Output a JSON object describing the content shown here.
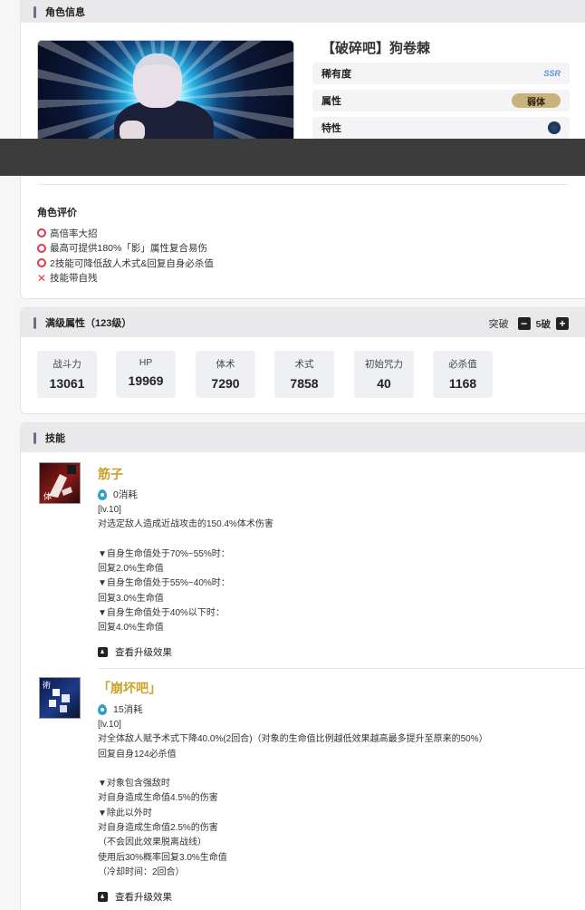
{
  "info": {
    "section_title": "角色信息",
    "char_name": "【破碎吧】狗卷棘",
    "attrs": {
      "rarity_label": "稀有度",
      "rarity_value": "SSR",
      "type_label": "属性",
      "type_value": "弱体",
      "trait_label": "特性"
    },
    "eval_title": "角色评价",
    "eval_items": [
      {
        "mark": "o",
        "text": "高倍率大招"
      },
      {
        "mark": "o",
        "text": "最高可提供180%「影」属性复合易伤"
      },
      {
        "mark": "o",
        "text": "2技能可降低敌人术式&回复自身必杀值"
      },
      {
        "mark": "x",
        "text": "技能带自残"
      }
    ]
  },
  "stats": {
    "section_title": "满级属性（123级）",
    "breakthrough_label": "突破",
    "breakthrough_value": "5破",
    "items": [
      {
        "label": "战斗力",
        "value": "13061"
      },
      {
        "label": "HP",
        "value": "19969"
      },
      {
        "label": "体术",
        "value": "7290"
      },
      {
        "label": "术式",
        "value": "7858"
      },
      {
        "label": "初始咒力",
        "value": "40"
      },
      {
        "label": "必杀值",
        "value": "1168"
      }
    ]
  },
  "skills": {
    "section_title": "技能",
    "list": [
      {
        "name": "筋子",
        "icon_tag": "体",
        "cost": "0消耗",
        "description": "[lv.10]\n对选定敌人造成近战攻击的150.4%体术伤害\n\n▼自身生命值处于70%~55%时：\n回复2.0%生命值\n▼自身生命值处于55%~40%时：\n回复3.0%生命值\n▼自身生命值处于40%以下时：\n回复4.0%生命值",
        "upgrade_label": "查看升级效果"
      },
      {
        "name": "「崩坏吧」",
        "icon_tag": "術",
        "cost": "15消耗",
        "description": "[lv.10]\n对全体敌人赋予术式下降40.0%(2回合)（对象的生命值比例越低效果越高最多提升至原来的50%）\n回复自身124必杀值\n\n▼对象包含强敌时\n对自身造成生命值4.5%的伤害\n▼除此以外时\n对自身造成生命值2.5%的伤害\n（不会因此效果脱离战线）\n使用后30%概率回复3.0%生命值\n（冷却时间：2回合）",
        "upgrade_label": "查看升级效果"
      }
    ]
  },
  "colors": {
    "accent_gold": "#c9a227",
    "mark_red": "#e2374a",
    "type_badge": "#cbb27c"
  }
}
